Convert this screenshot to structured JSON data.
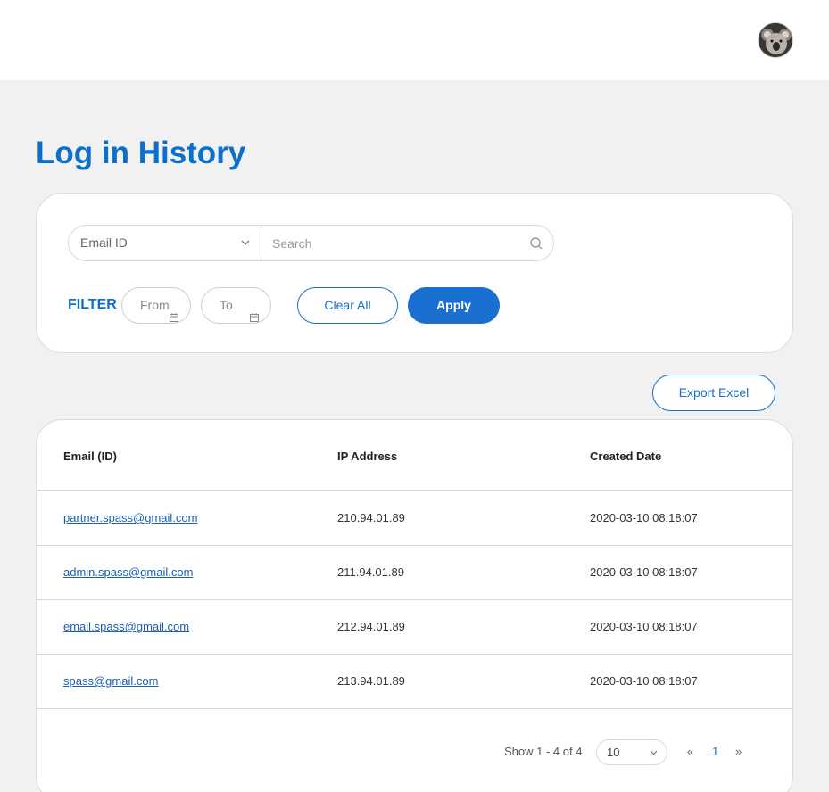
{
  "header": {
    "avatar_alt": "user avatar"
  },
  "page": {
    "title": "Log in History"
  },
  "filters": {
    "search_type": "Email ID",
    "search_placeholder": "Search",
    "filter_label": "FILTER",
    "from_placeholder": "From",
    "to_placeholder": "To",
    "clear_label": "Clear All",
    "apply_label": "Apply"
  },
  "actions": {
    "export_label": "Export Excel"
  },
  "table": {
    "columns": [
      "Email (ID)",
      "IP Address",
      "Created Date"
    ],
    "rows": [
      {
        "email": "partner.spass@gmail.com",
        "ip": "210.94.01.89",
        "created": "2020-03-10 08:18:07"
      },
      {
        "email": "admin.spass@gmail.com",
        "ip": "211.94.01.89",
        "created": "2020-03-10 08:18:07"
      },
      {
        "email": "email.spass@gmail.com",
        "ip": "212.94.01.89",
        "created": "2020-03-10 08:18:07"
      },
      {
        "email": "spass@gmail.com",
        "ip": "213.94.01.89",
        "created": "2020-03-10 08:18:07"
      }
    ]
  },
  "pagination": {
    "info": "Show 1 - 4 of 4",
    "page_size": "10",
    "prev": "«",
    "current_page": "1",
    "next": "»"
  },
  "colors": {
    "accent": "#0e6fcb",
    "background": "#f1f1f1"
  }
}
